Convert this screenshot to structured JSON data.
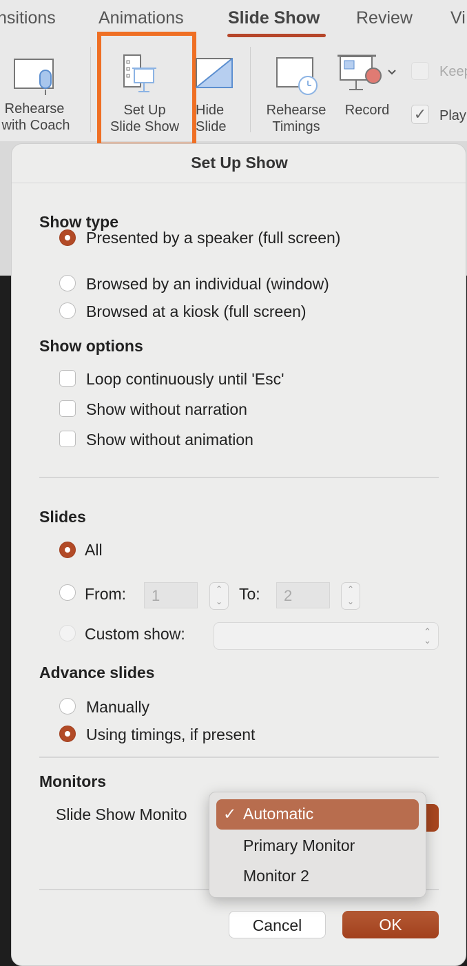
{
  "ribbon": {
    "tabs": [
      "nsitions",
      "Animations",
      "Slide Show",
      "Review",
      "Vi"
    ],
    "buttons": {
      "coach": [
        "Rehearse",
        "with Coach"
      ],
      "setup": [
        "Set Up",
        "Slide Show"
      ],
      "hide": [
        "Hide",
        "Slide"
      ],
      "timings": [
        "Rehearse",
        "Timings"
      ],
      "record": "Record",
      "keep": "Keep",
      "play": "Play"
    }
  },
  "dialog": {
    "title": "Set Up Show",
    "show_type": {
      "heading": "Show type",
      "options": [
        "Presented by a speaker (full screen)",
        "Browsed by an individual (window)",
        "Browsed at a kiosk (full screen)"
      ],
      "selected": 0
    },
    "show_options": {
      "heading": "Show options",
      "options": [
        "Loop continuously until 'Esc'",
        "Show without narration",
        "Show without animation"
      ]
    },
    "slides": {
      "heading": "Slides",
      "all": "All",
      "from": "From:",
      "from_value": "1",
      "to": "To:",
      "to_value": "2",
      "custom": "Custom show:"
    },
    "advance": {
      "heading": "Advance slides",
      "options": [
        "Manually",
        "Using timings, if present"
      ],
      "selected": 1
    },
    "monitors": {
      "heading": "Monitors",
      "label": "Slide Show Monito",
      "menu": [
        "Automatic",
        "Primary Monitor",
        "Monitor 2"
      ],
      "selected": "Automatic",
      "check": "✓"
    },
    "cancel": "Cancel",
    "ok": "OK"
  },
  "colors": {
    "accent": "#b24a26",
    "highlight": "#ef6f24"
  }
}
